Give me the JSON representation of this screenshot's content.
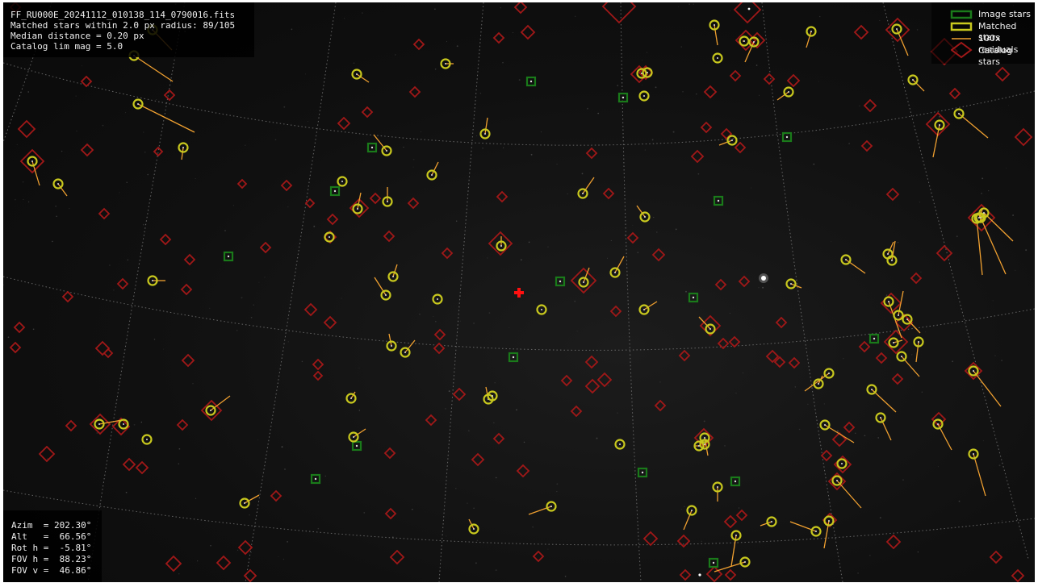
{
  "header": {
    "filename": "FF_RU000E_20241112_010138_114_0790016.fits",
    "matched_line": "Matched stars within 2.0 px radius: 89/105",
    "median_line": "Median distance = 0.20 px",
    "limmag_line": "Catalog lim mag = 5.0"
  },
  "legend": {
    "image_stars": "Image stars",
    "matched_stars": "Matched stars",
    "residuals": "100x residuals",
    "catalog_stars": "Catalog stars"
  },
  "pointing": {
    "azim": "Azim  = 202.30°",
    "alt": "Alt   =  66.56°",
    "rot": "Rot h =  -5.81°",
    "fov_h": "FOV h =  88.23°",
    "fov_v": "FOV v =  46.86°"
  },
  "colors": {
    "image_star": "#1a7a1a",
    "matched_star": "#c8c81e",
    "residual": "#f0a030",
    "catalog_star": "#a01818",
    "center_cross": "#ff1010",
    "grid": "#7a7a7a"
  },
  "icons": {
    "center_marker": "red-cross-icon"
  }
}
